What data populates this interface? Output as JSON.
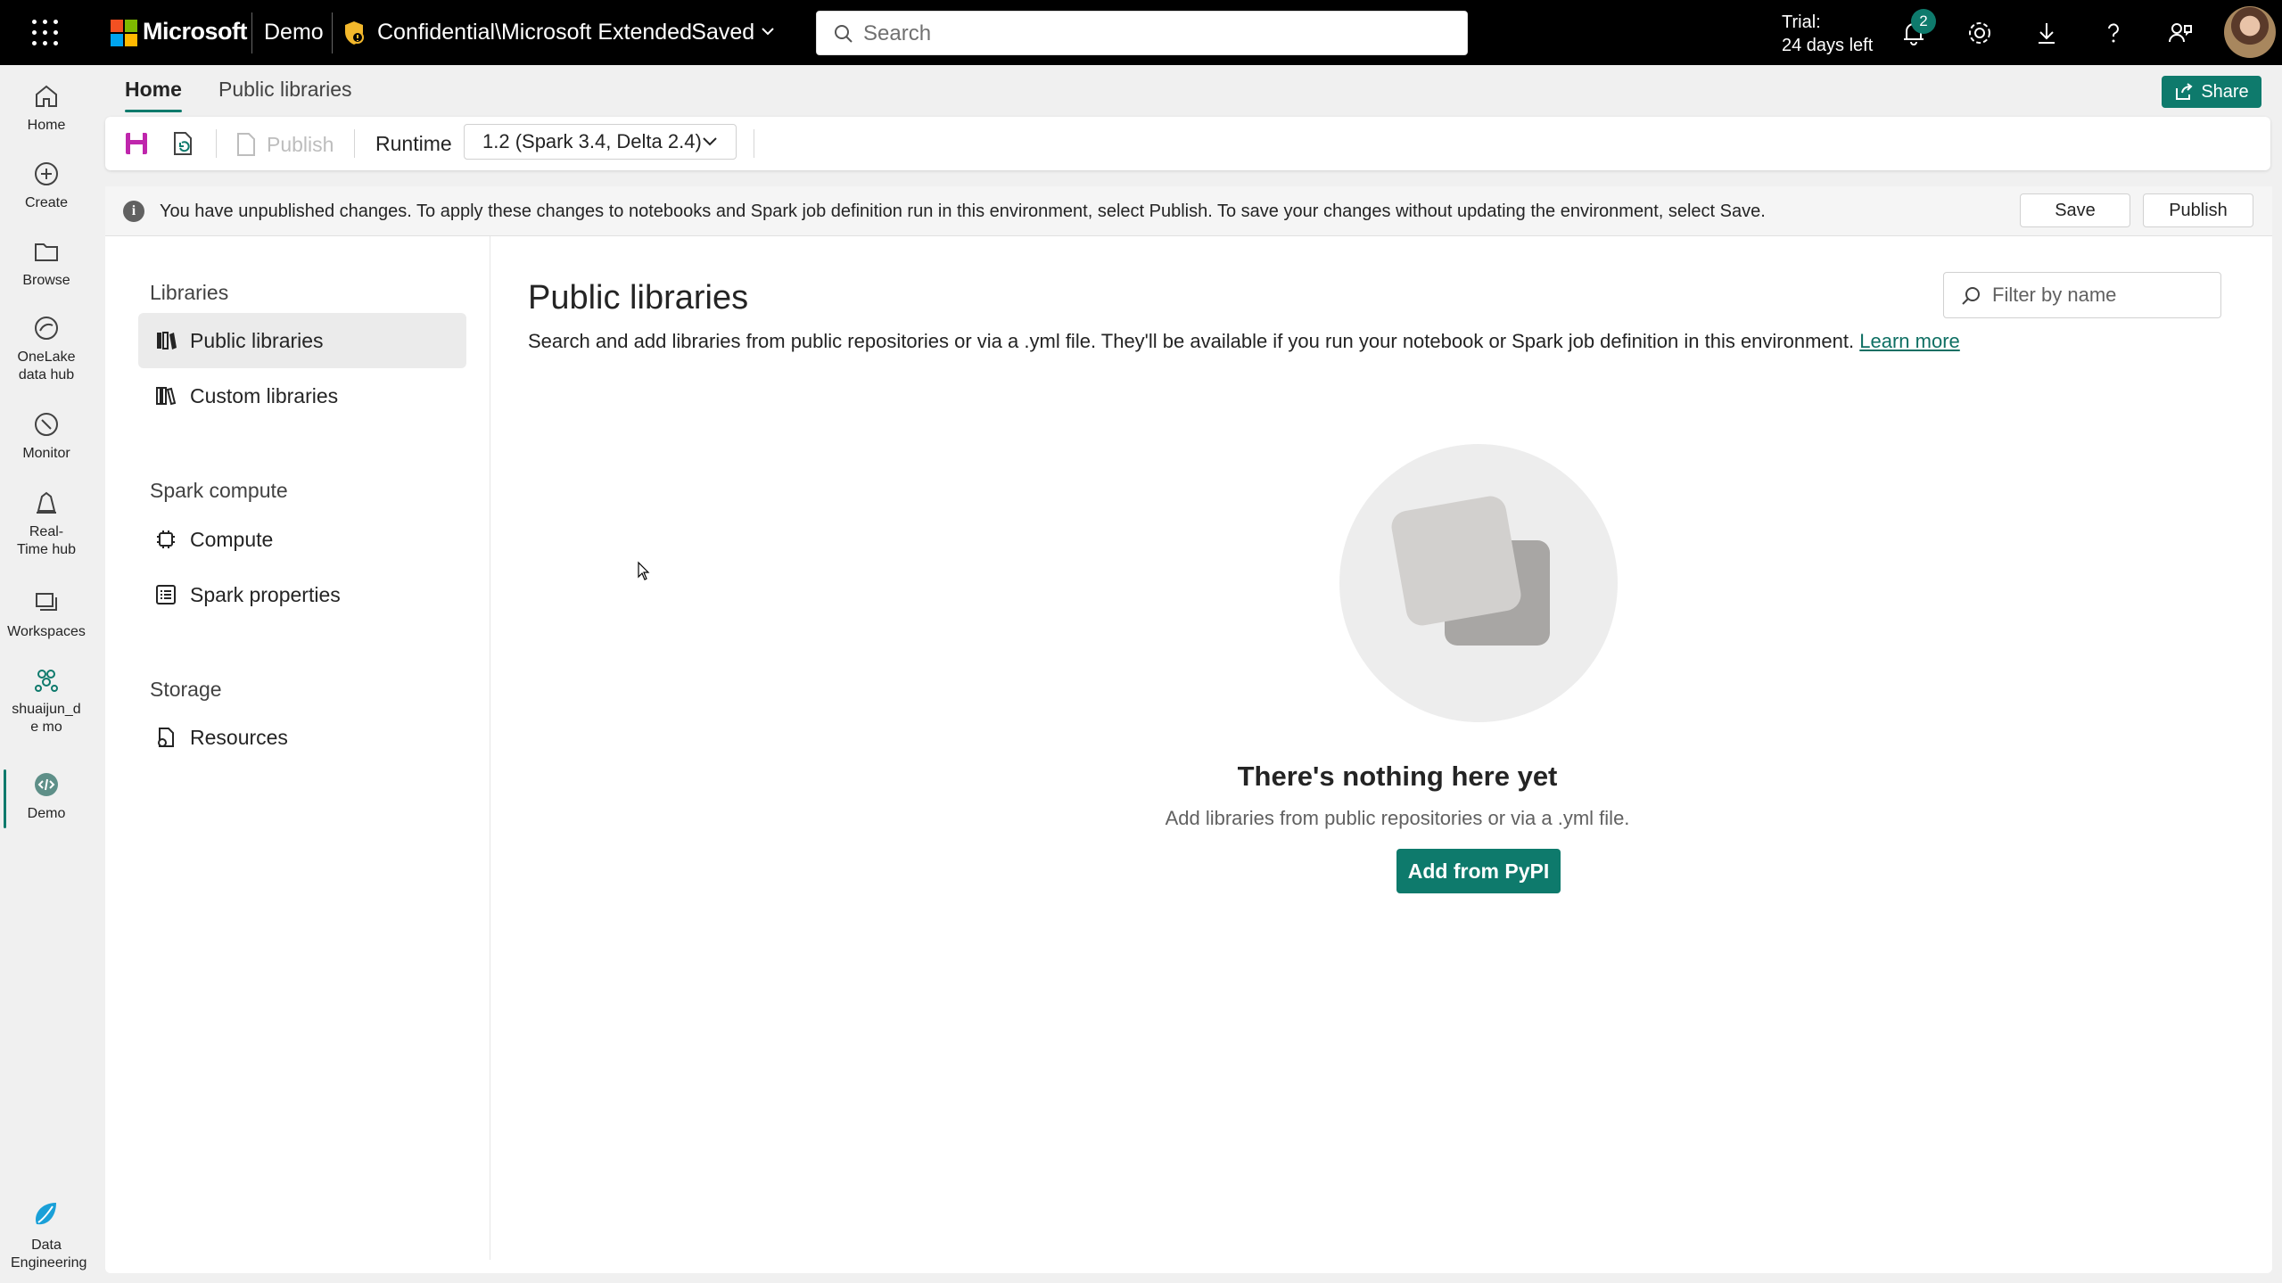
{
  "topbar": {
    "brand": "Microsoft",
    "workspace": "Demo",
    "document": "Confidential\\Microsoft Extended",
    "save_state": "· Saved",
    "search_placeholder": "Search",
    "trial_line1": "Trial:",
    "trial_line2": "24 days left",
    "notification_count": "2"
  },
  "rail": {
    "items": [
      {
        "label": "Home"
      },
      {
        "label": "Create"
      },
      {
        "label": "Browse"
      },
      {
        "label": "OneLake data hub"
      },
      {
        "label": "Monitor"
      },
      {
        "label": "Real-Time hub"
      },
      {
        "label": "Workspaces"
      },
      {
        "label": "shuaijun_de mo"
      },
      {
        "label": "Demo"
      }
    ],
    "footer": {
      "label": "Data Engineering"
    }
  },
  "tabs": [
    "Home",
    "Public libraries"
  ],
  "share_label": "Share",
  "toolbar": {
    "publish_label": "Publish",
    "runtime_label": "Runtime",
    "runtime_value": "1.2 (Spark 3.4, Delta 2.4)"
  },
  "banner": {
    "message": "You have unpublished changes. To apply these changes to notebooks and Spark job definition run in this environment, select Publish. To save your changes without updating the environment, select Save.",
    "save_label": "Save",
    "publish_label": "Publish"
  },
  "leftnav": {
    "libraries_heading": "Libraries",
    "public_libraries": "Public libraries",
    "custom_libraries": "Custom libraries",
    "spark_heading": "Spark compute",
    "compute": "Compute",
    "spark_properties": "Spark properties",
    "storage_heading": "Storage",
    "resources": "Resources"
  },
  "main": {
    "title": "Public libraries",
    "description": "Search and add libraries from public repositories or via a .yml file. They'll be available if you run your notebook or Spark job definition in this environment.",
    "learn_more": "Learn more",
    "filter_placeholder": "Filter by name",
    "empty_title": "There's nothing here yet",
    "empty_subtitle": "Add libraries from public repositories or via a .yml file.",
    "add_button": "Add from PyPI"
  },
  "colors": {
    "accent": "#0e7a6c",
    "topbar": "#000000"
  }
}
